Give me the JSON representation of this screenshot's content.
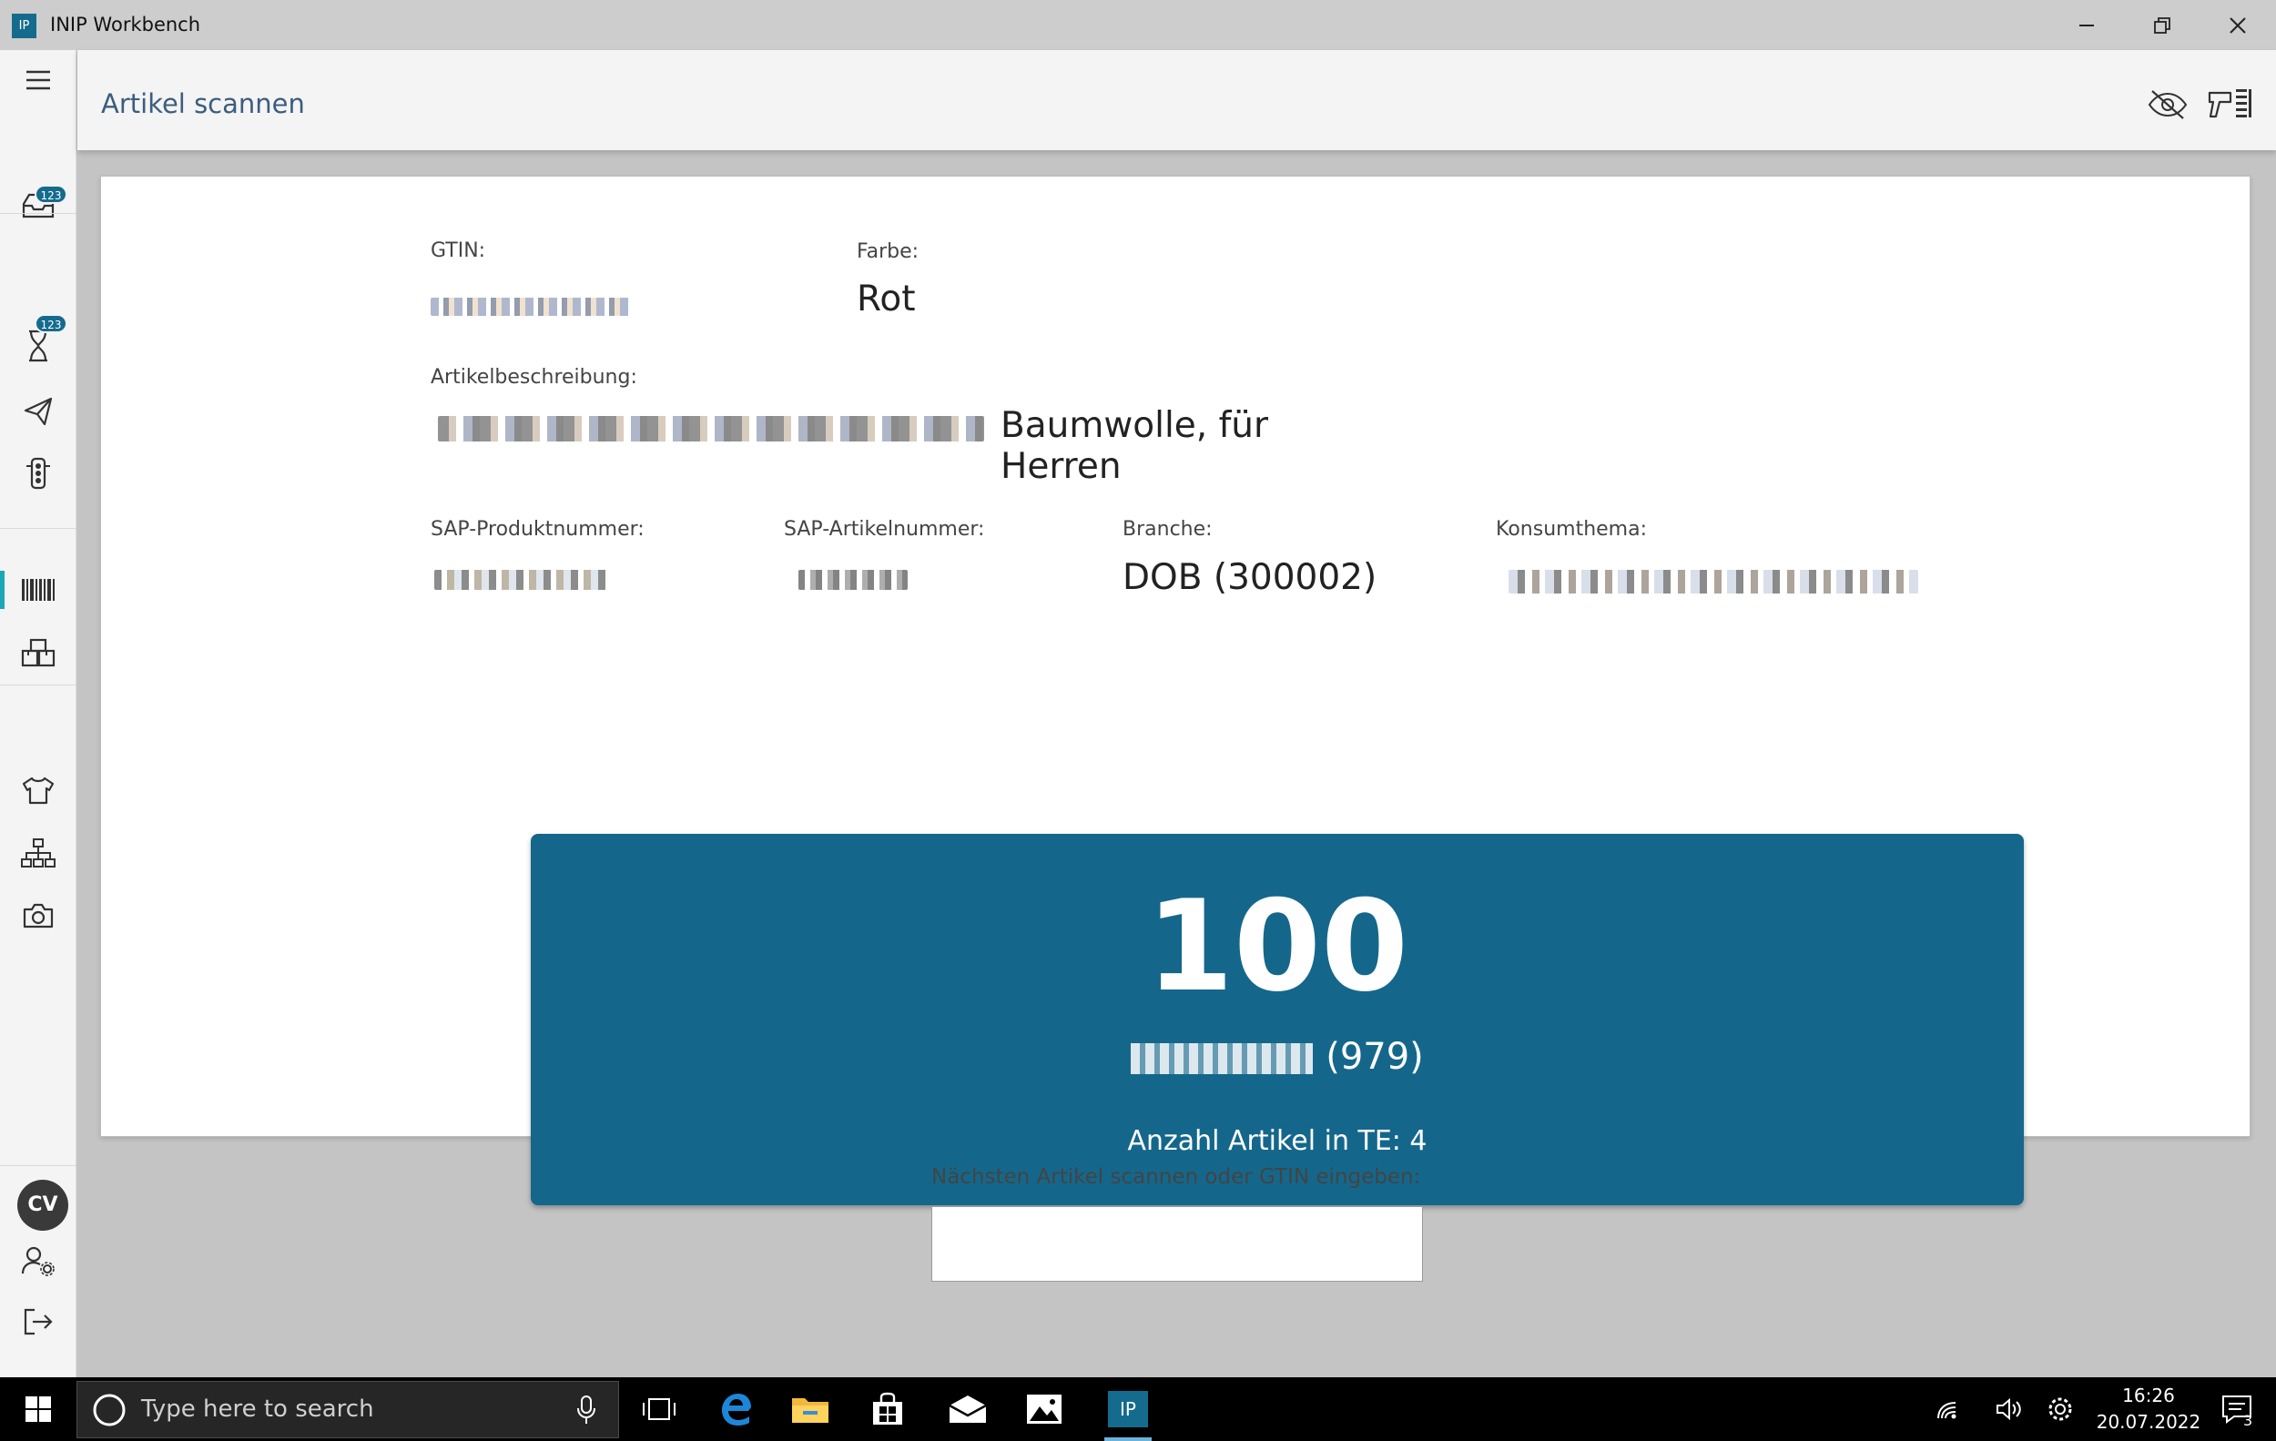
{
  "window": {
    "app_icon_text": "IP",
    "title": "INIP Workbench"
  },
  "sidebar": {
    "badges": [
      "123",
      "123"
    ],
    "avatar_initials": "CV",
    "active_item": "barcode-scan"
  },
  "header": {
    "page_title": "Artikel scannen"
  },
  "article": {
    "gtin_label": "GTIN:",
    "farbe_label": "Farbe:",
    "farbe_value": "Rot",
    "beschreibung_label": "Artikelbeschreibung:",
    "beschreibung_value_visible": "Baumwolle, für Herren",
    "sap_produkt_label": "SAP-Produktnummer:",
    "sap_artikel_label": "SAP-Artikelnummer:",
    "branche_label": "Branche:",
    "branche_value": "DOB (300002)",
    "konsumthema_label": "Konsumthema:"
  },
  "count_panel": {
    "count": "100",
    "sub_code": "(979)",
    "items_text": "Anzahl Artikel in TE: 4"
  },
  "scan": {
    "label": "Nächsten Artikel scannen oder GTIN eingeben:",
    "value": ""
  },
  "taskbar": {
    "search_placeholder": "Type here to search",
    "active_app_text": "IP",
    "time": "16:26",
    "date": "20.07.2022",
    "notification_count": "3"
  },
  "colors": {
    "accent": "#14678b",
    "active_indicator": "#1aa7b8",
    "title_text": "#3c5d7e"
  }
}
